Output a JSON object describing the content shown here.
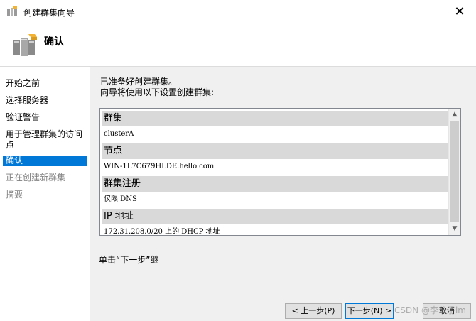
{
  "window": {
    "title": "创建群集向导",
    "close_label": "✕"
  },
  "header": {
    "title": "确认"
  },
  "nav": {
    "items": [
      {
        "label": "开始之前",
        "state": "normal"
      },
      {
        "label": "选择服务器",
        "state": "normal"
      },
      {
        "label": "验证警告",
        "state": "normal"
      },
      {
        "label": "用于管理群集的访问点",
        "state": "normal"
      },
      {
        "label": "确认",
        "state": "active"
      },
      {
        "label": "正在创建新群集",
        "state": "disabled"
      },
      {
        "label": "摘要",
        "state": "disabled"
      }
    ]
  },
  "main": {
    "intro_line1": "已准备好创建群集。",
    "intro_line2": "向导将使用以下设置创建群集:",
    "settings": [
      {
        "heading": "群集",
        "value": "clusterA"
      },
      {
        "heading": "节点",
        "value": "WIN-1L7C679HLDE.hello.com"
      },
      {
        "heading": "群集注册",
        "value": "仅限 DNS"
      },
      {
        "heading": "IP 地址",
        "value": "172.31.208.0/20 上的 DHCP 地址"
      }
    ],
    "hint": "单击“下一步”继"
  },
  "buttons": {
    "prev": "< 上一步(P)",
    "next": "下一步(N) >",
    "cancel": "取消"
  },
  "watermark": "CSDN @李公子lm",
  "colors": {
    "accent": "#0078d7",
    "panel": "#f0f0f0",
    "row_header": "#d9d9d9"
  }
}
